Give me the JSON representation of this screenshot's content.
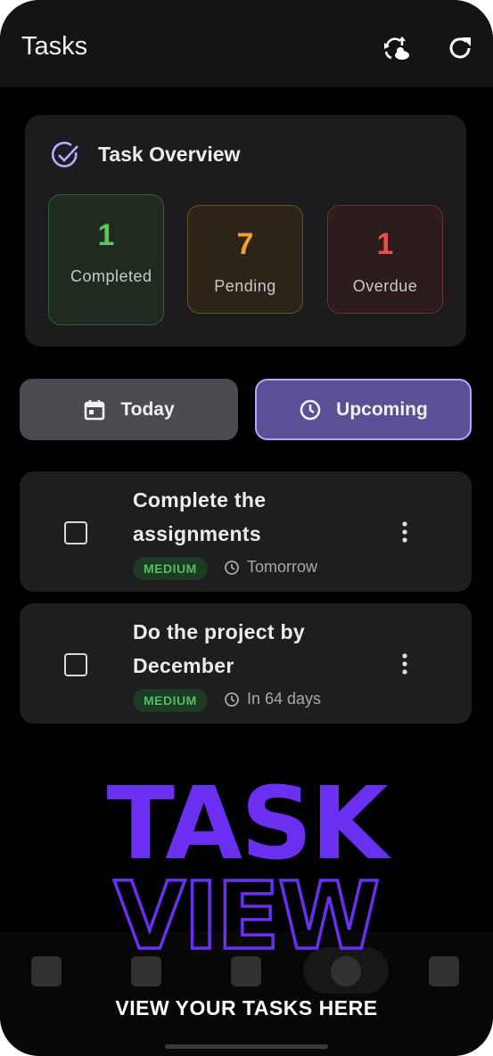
{
  "appbar": {
    "title": "Tasks",
    "icons": [
      "sync-cloud-icon",
      "refresh-icon"
    ]
  },
  "overview": {
    "title": "Task Overview",
    "icon": "check-circle-icon",
    "stats": [
      {
        "value": "1",
        "label": "Completed",
        "color": "#5cc75c"
      },
      {
        "value": "7",
        "label": "Pending",
        "color": "#f5a02a"
      },
      {
        "value": "1",
        "label": "Overdue",
        "color": "#e65050"
      }
    ]
  },
  "filters": {
    "today": {
      "label": "Today",
      "icon": "calendar-icon"
    },
    "upcoming": {
      "label": "Upcoming",
      "icon": "clock-icon",
      "selected": true
    }
  },
  "tasks": [
    {
      "title": "Complete the assignments",
      "priority": "MEDIUM",
      "due": "Tomorrow",
      "checked": false
    },
    {
      "title": "Do the project by December",
      "priority": "MEDIUM",
      "due": "In 64 days",
      "checked": false
    }
  ],
  "promo": {
    "headline_top": "TASK",
    "headline_bottom": "VIEW",
    "subtitle": "VIEW YOUR TASKS HERE"
  },
  "colors": {
    "accent": "#6a2ff0",
    "upcoming_bg": "#5b4f96",
    "upcoming_border": "#b3a6ff",
    "priority_medium": "#4fbf5f"
  }
}
